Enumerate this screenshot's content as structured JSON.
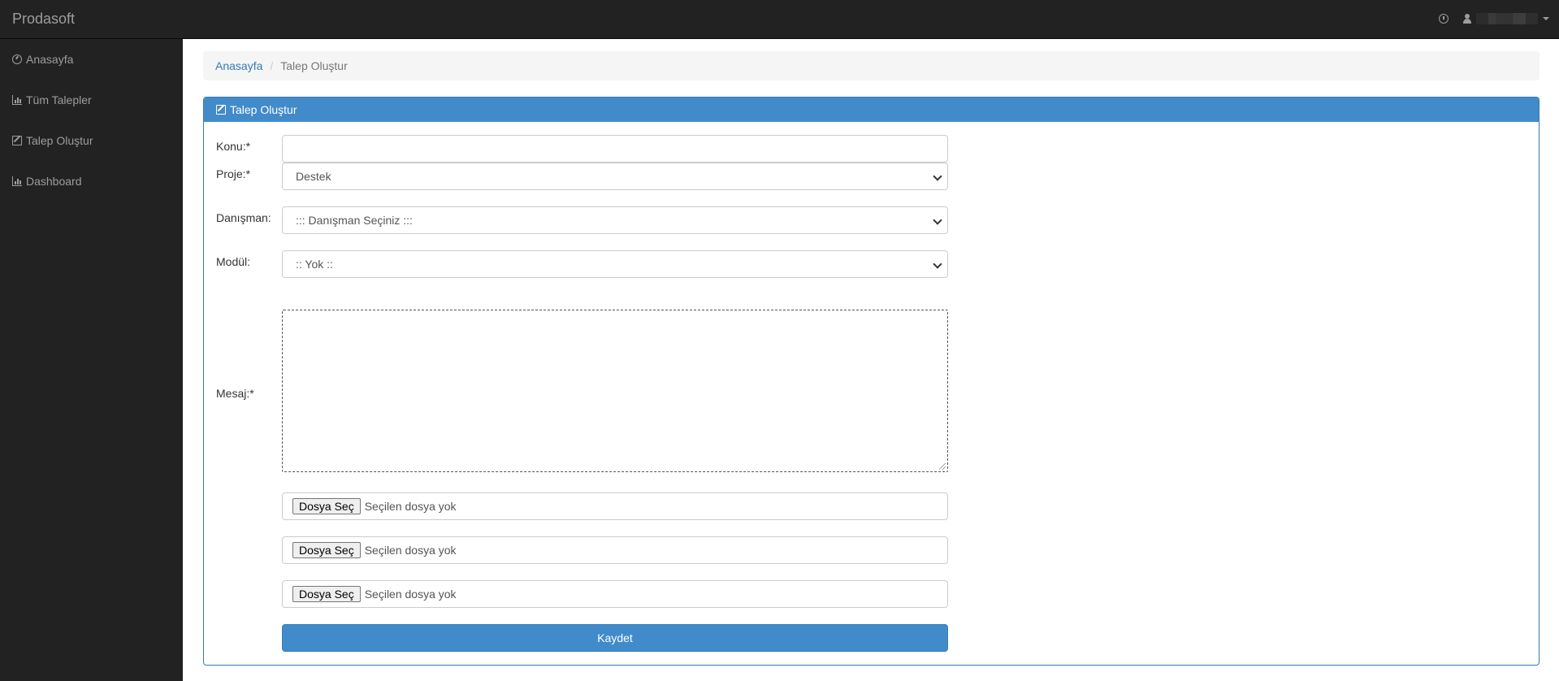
{
  "app": {
    "brand": "Prodasoft"
  },
  "header": {
    "icons": [
      "clock-icon",
      "user-icon",
      "caret-down-icon"
    ]
  },
  "sidebar": {
    "items": [
      {
        "label": "Anasayfa",
        "icon": "dashboard-icon"
      },
      {
        "label": "Tüm Talepler",
        "icon": "bar-chart-icon"
      },
      {
        "label": "Talep Oluştur",
        "icon": "edit-icon"
      },
      {
        "label": "Dashboard",
        "icon": "bar-chart-icon"
      }
    ]
  },
  "breadcrumb": {
    "home": "Anasayfa",
    "separator": "/",
    "current": "Talep Oluştur"
  },
  "panel": {
    "title": "Talep Oluştur",
    "icon": "edit-icon",
    "accent_color": "#428bca"
  },
  "form": {
    "konu": {
      "label": "Konu:*",
      "value": ""
    },
    "proje": {
      "label": "Proje:*",
      "value": "Destek"
    },
    "danisman": {
      "label": "Danışman:",
      "value": "::: Danışman Seçiniz :::"
    },
    "modul": {
      "label": "Modül:",
      "value": ":: Yok ::"
    },
    "mesaj": {
      "label": "Mesaj:*",
      "value": ""
    },
    "files": [
      {
        "button": "Dosya Seç",
        "status": "Seçilen dosya yok"
      },
      {
        "button": "Dosya Seç",
        "status": "Seçilen dosya yok"
      },
      {
        "button": "Dosya Seç",
        "status": "Seçilen dosya yok"
      }
    ],
    "submit_label": "Kaydet"
  }
}
